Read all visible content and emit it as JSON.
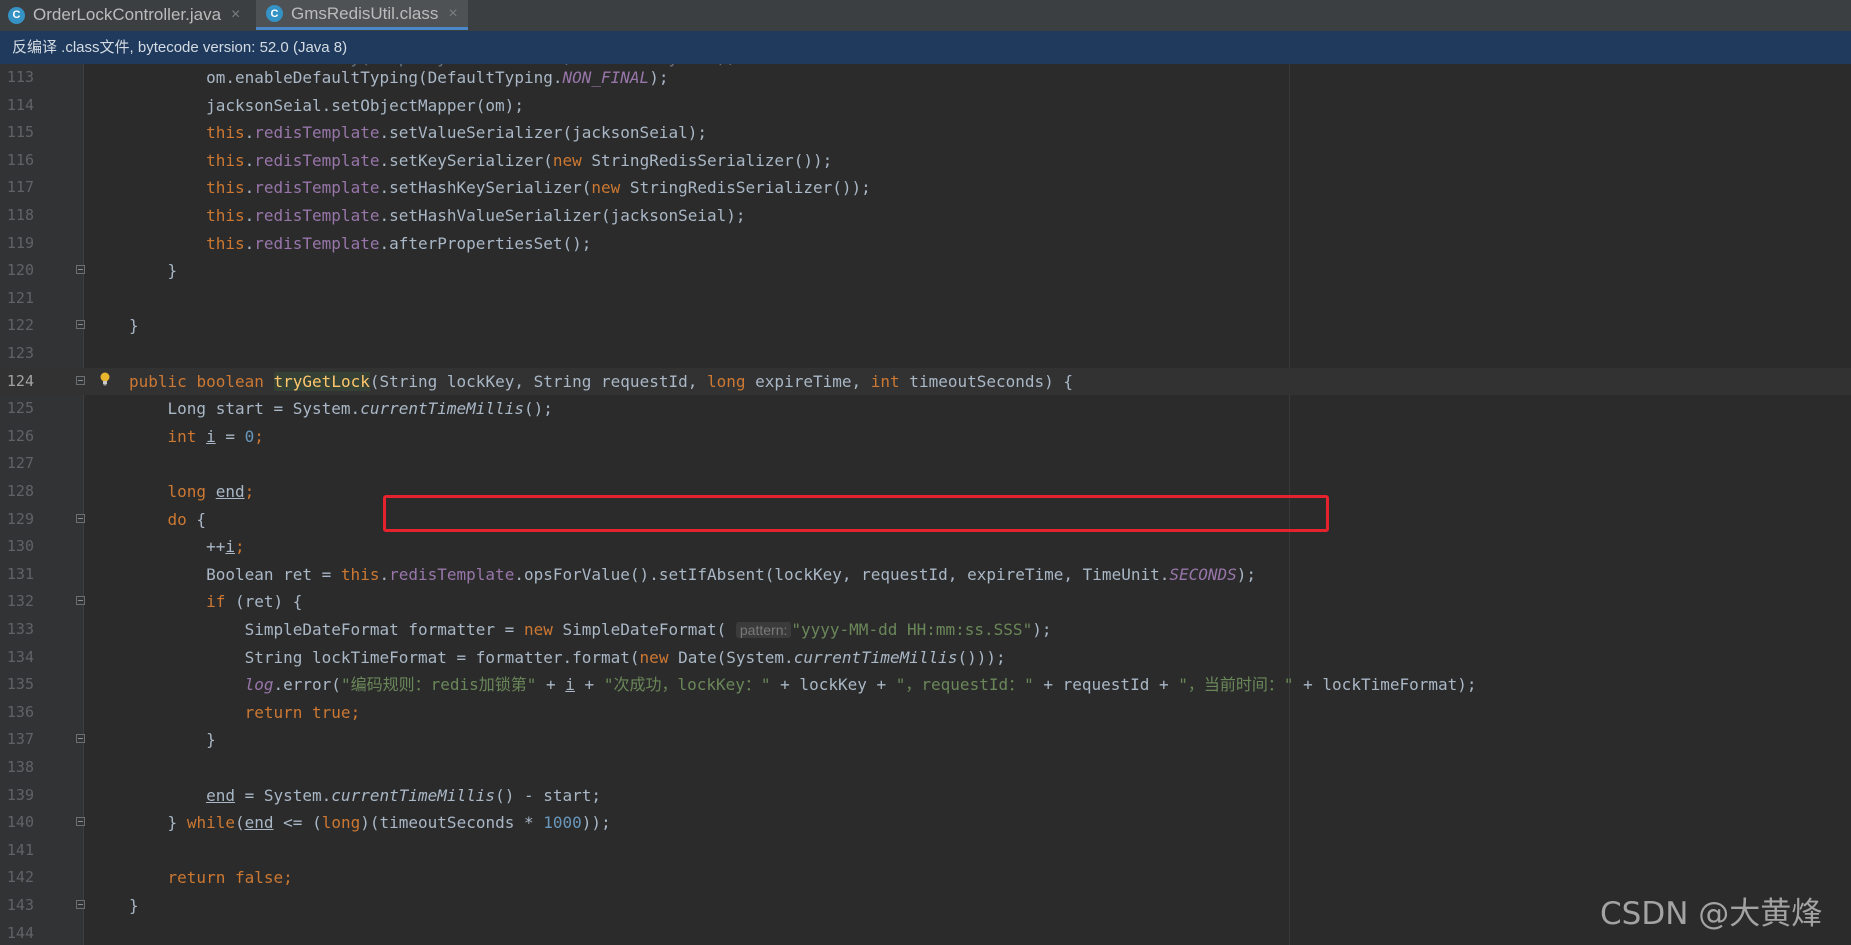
{
  "tabs": [
    {
      "icon": "class-c-icon",
      "label": "OrderLockController.java",
      "close": "×"
    },
    {
      "icon": "class-c-icon",
      "label": "GmsRedisUtil.class",
      "close": "×"
    }
  ],
  "banner": {
    "text": "反编译 .class文件, bytecode version: 52.0 (Java 8)"
  },
  "editor": {
    "lines": [
      {
        "n": "113"
      },
      {
        "n": "114"
      },
      {
        "n": "115"
      },
      {
        "n": "116"
      },
      {
        "n": "117"
      },
      {
        "n": "118"
      },
      {
        "n": "119"
      },
      {
        "n": "120"
      },
      {
        "n": "121"
      },
      {
        "n": "122"
      },
      {
        "n": "123"
      },
      {
        "n": "124"
      },
      {
        "n": "125"
      },
      {
        "n": "126"
      },
      {
        "n": "127"
      },
      {
        "n": "128"
      },
      {
        "n": "129"
      },
      {
        "n": "130"
      },
      {
        "n": "131"
      },
      {
        "n": "132"
      },
      {
        "n": "133"
      },
      {
        "n": "134"
      },
      {
        "n": "135"
      },
      {
        "n": "136"
      },
      {
        "n": "137"
      },
      {
        "n": "138"
      },
      {
        "n": "139"
      },
      {
        "n": "140"
      },
      {
        "n": "141"
      },
      {
        "n": "142"
      },
      {
        "n": "143"
      },
      {
        "n": "144"
      }
    ],
    "tokens": {
      "om_default": "om.enableDefaultTyping(DefaultTyping.",
      "non_final": "NON_FINAL",
      "close_paren_semi": ");",
      "jackson_set_mapper": "jacksonSeial.setObjectMapper(om);",
      "this": "this",
      "dot": ".",
      "redis_template": "redisTemplate",
      "set_value_ser": ".setValueSerializer(jacksonSeial);",
      "set_key_ser_a": ".setKeySerializer(",
      "new": "new",
      "string_redis_ser": " StringRedisSerializer());",
      "set_hash_key_ser_a": ".setHashKeySerializer(",
      "set_hash_value_ser": ".setHashValueSerializer(jacksonSeial);",
      "after_props": ".afterPropertiesSet();",
      "brace_close": "}",
      "public": "public",
      "boolean": "boolean",
      "try_get_lock": "tryGetLock",
      "sig_a": "(String lockKey, String requestId, ",
      "long": "long",
      "sig_b": " expireTime, ",
      "int": "int",
      "sig_c": " timeoutSeconds) {",
      "long_start": "Long start = System.",
      "current_time_millis": "currentTimeMillis",
      "call_semi": "();",
      "var_i": "i",
      "eq": " = ",
      "zero": "0",
      "semi": ";",
      "var_end": "end",
      "do_brace": " {",
      "do": "do",
      "pre_inc": "++",
      "boolean_ret": "Boolean ret = ",
      "set_if_absent": ".opsForValue().setIfAbsent(lockKey, requestId, expireTime, TimeUnit.",
      "seconds": "SECONDS",
      "if": "if",
      "if_ret": " (ret) {",
      "sdf_a": "SimpleDateFormat formatter = ",
      "sdf_b": " SimpleDateFormat(",
      "pattern_hint": "pattern:",
      "pattern_str": "\"yyyy-MM-dd HH:mm:ss.SSS\"",
      "lock_time_a": "String lockTimeFormat = formatter.format(",
      "date_a": " Date(System.",
      "triple_close": "()));",
      "log": "log",
      "error_a": ".error(",
      "str1": "\"编码规则：redis加锁第\"",
      "plus": " + ",
      "str2": "\"次成功，lockKey：\"",
      "lockkey_plus": " + lockKey + ",
      "str3": "\"，requestId：\"",
      "reqid_plus": " + requestId + ",
      "str4": "\"，当前时间：\"",
      "lock_time_end": " + lockTimeFormat);",
      "return": "return",
      "true": "true",
      "false": "false",
      "end_assign_b": "() - start;",
      "while": "while",
      "while_a": "(",
      "while_b": " <= (",
      "while_c": ")(timeoutSeconds * ",
      "thousand": "1000",
      "while_d": "));"
    }
  },
  "watermark": {
    "text": "CSDN @大黄烽"
  },
  "colors": {
    "background": "#2b2b2b",
    "keyword": "#cc7832",
    "field": "#9876aa",
    "string": "#6a8759",
    "number": "#6897bb",
    "method_decl": "#ffc66d",
    "highlight_box": "#e4232f",
    "banner": "#1f3a5c"
  }
}
